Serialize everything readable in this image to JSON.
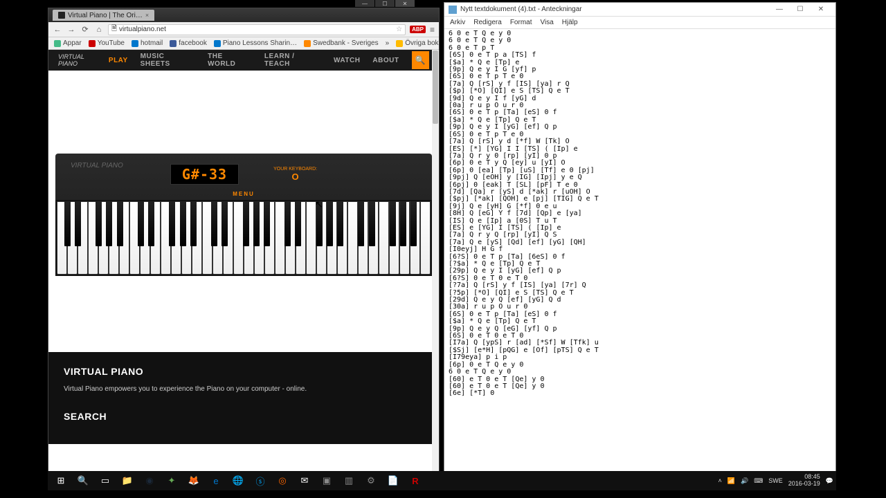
{
  "browser": {
    "tab_title": "Virtual Piano | The Ori…",
    "url": "virtualpiano.net",
    "bookmarks": [
      "Appar",
      "YouTube",
      "hotmail",
      "facebook",
      "Piano Lessons Sharin…",
      "Swedbank - Sveriges",
      "»",
      "Övriga bokmärken"
    ]
  },
  "vp": {
    "nav": [
      "PLAY",
      "MUSIC SHEETS",
      "THE WORLD",
      "LEARN / TEACH",
      "WATCH",
      "ABOUT"
    ],
    "brand": "VIRTUAL PIANO",
    "note": "G#-33",
    "kb_label": "YOUR KEYBOARD:",
    "kb_value": "O",
    "menu": "MENU",
    "footer_h1": "VIRTUAL PIANO",
    "footer_text": "Virtual Piano empowers you to experience the Piano on your computer - online.",
    "footer_h2": "SEARCH"
  },
  "notepad": {
    "title": "Nytt textdokument (4).txt - Anteckningar",
    "menu": [
      "Arkiv",
      "Redigera",
      "Format",
      "Visa",
      "Hjälp"
    ],
    "content": "6 0 e T Q e y 0\n6 0 e T Q e y 0\n6 0 e T p T\n[6S] 0 e T p a [TS] f\n[$a] * Q e [Tp] e\n[9p] Q e y I G [yf] p\n[6S] 0 e T p T e 0\n[7a] Q [rS] y f [IS] [ya] r Q\n[$p] [*O] [QI] e S [TS] Q e T\n[9d] Q e y I f [yG] d\n[0a] r u p O u r 0\n[6S] 0 e T p [Ta] [eS] 0 f\n[$a] * Q e [Tp] Q e T\n[9p] Q e y I [yG] [ef] Q p\n[6S] 0 e T p T e 0\n[7a] Q [rS] y d [*f] W [Tk] O\n[ES] [*] [YG] I I [TS] ( [Ip] e\n[7a] Q r y 0 [rp] [yI] 0 p\n[6p] 0 e T y Q [ey] u [yI] O\n[6p] 0 [ea] [Tp] [uS] [Tf] e 0 [pj]\n[9pj] Q [eOH] y [IG] [Ipj] y e Q\n[6pj] 0 [eak] T [SL] [pF] T e 0\n[7d] [Qa] r [yS] d [*ak] r [uOH] O\n[$pj] [*ak] [QOH] e [pj] [TIG] Q e T\n[9j] Q e [yH] G [*f] 0 e u\n[8H] Q [eG] Y f [7d] [Qp] e [ya]\n[IS] Q e [Ip] a [0S] T u T\n[ES] e [YG] I [TS] ( [Ip] e\n[7a] Q r y Q [rp] [yI] Q S\n[7a] Q e [yS] [Qd] [ef] [yG] [QH]\n[I0eyj] H G f\n[6?S] 0 e T p [Ta] [6eS] 0 f\n[?$a] * Q e [Tp] Q e T\n[29p] Q e y I [yG] [ef] Q p\n[6?S] 0 e T 0 e T 0\n[?7a] Q [rS] y f [IS] [ya] [7r] Q\n[?5p] [*O] [QI] e S [TS] Q e T\n[29d] Q e y Q [ef] [yG] Q d\n[30a] r u p O u r 0\n[6S] 0 e T p [Ta] [eS] 0 f\n[$a] * Q e [Tp] Q e T\n[9p] Q e y Q [eG] [yf] Q p\n[6S] 0 e T 0 e T 0\n[I7a] Q [ypS] r [ad] [*Sf] W [Tfk] u\n[$Sj] [e*H] [pQG] e [Of] [pTS] Q e T\n[I79eya] p i p\n[6p] 0 e T Q e y 0\n6 0 e T Q e y 0\n[60] e T 0 e T [Qe] y 0\n[60] e T 0 e T [Qe] y 0\n[6e] [*T] 0"
  },
  "tray": {
    "lang": "SWE",
    "time": "08:45",
    "date": "2016-03-19"
  }
}
